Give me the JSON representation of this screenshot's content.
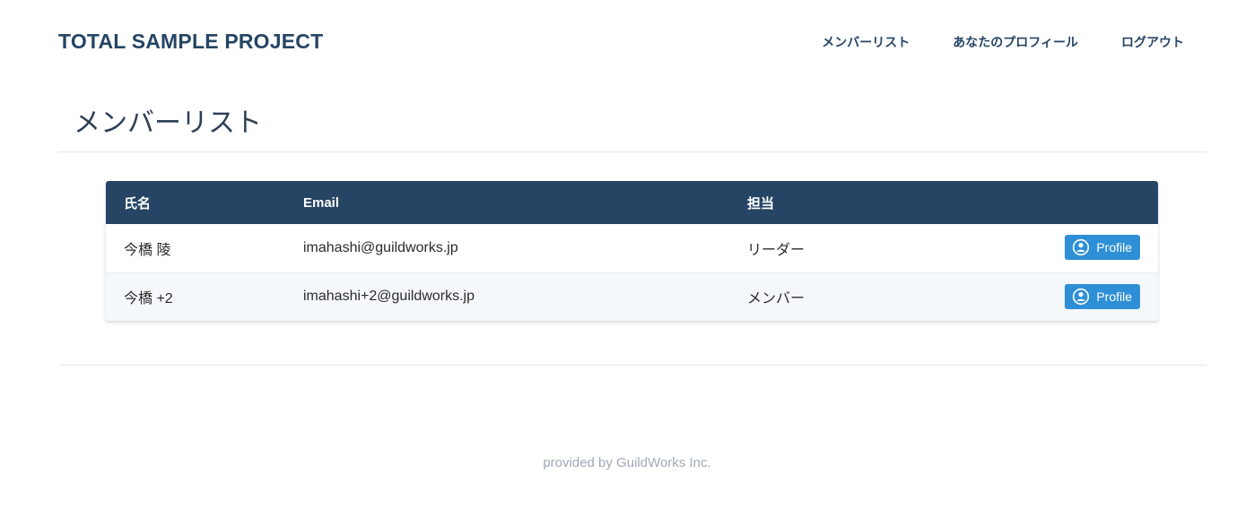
{
  "header": {
    "brand": "TOTAL SAMPLE PROJECT",
    "nav": [
      {
        "label": "メンバーリスト"
      },
      {
        "label": "あなたのプロフィール"
      },
      {
        "label": "ログアウト"
      }
    ]
  },
  "main": {
    "title": "メンバーリスト",
    "table": {
      "columns": [
        "氏名",
        "Email",
        "担当"
      ],
      "rows": [
        {
          "name": "今橋 陵",
          "email": "imahashi@guildworks.jp",
          "role": "リーダー",
          "action_label": "Profile",
          "action_icon": "user-circle-icon"
        },
        {
          "name": "今橋 +2",
          "email": "imahashi+2@guildworks.jp",
          "role": "メンバー",
          "action_label": "Profile",
          "action_icon": "user-circle-icon"
        }
      ]
    }
  },
  "footer": {
    "text": "provided by GuildWorks Inc."
  },
  "colors": {
    "brand": "#264564",
    "table_header_bg": "#264564",
    "button": "#2f8fd6",
    "footer_text": "#a0aab6"
  }
}
